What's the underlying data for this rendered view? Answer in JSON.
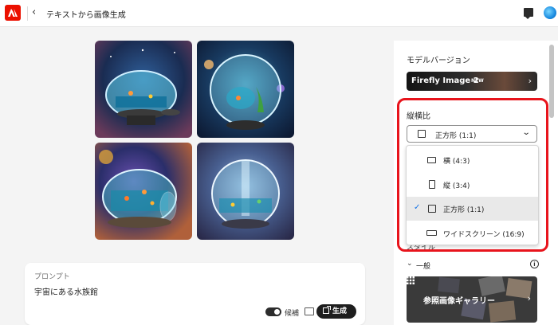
{
  "header": {
    "back_icon": "chevron-left-icon",
    "title": "テキストから画像生成"
  },
  "gallery_images": [
    {
      "id": "img1",
      "theme": "fishbowl-space-1"
    },
    {
      "id": "img2",
      "theme": "fishbowl-space-2"
    },
    {
      "id": "img3",
      "theme": "fishbowl-space-3"
    },
    {
      "id": "img4",
      "theme": "fishbowl-space-4"
    }
  ],
  "prompt": {
    "label": "プロンプト",
    "text": "宇宙にある水族館",
    "toggle_label": "候補",
    "generate_label": "生成"
  },
  "panel": {
    "model_section_label": "モデルバージョン",
    "model_name": "Firefly Image 2",
    "model_badge": "NEW",
    "aspect_label": "縦横比",
    "aspect_selected": "正方形 (1:1)",
    "aspect_options": [
      {
        "label": "横 (4:3)",
        "selected": false
      },
      {
        "label": "縦 (3:4)",
        "selected": false
      },
      {
        "label": "正方形 (1:1)",
        "selected": true
      },
      {
        "label": "ワイドスクリーン (16:9)",
        "selected": false
      }
    ],
    "style_label": "スタイル",
    "general_label": "一般",
    "gallery_label": "参照画像ギャラリー"
  },
  "colors": {
    "brand_red": "#eb1000",
    "highlight": "#e8141c",
    "check_blue": "#1473e6"
  }
}
